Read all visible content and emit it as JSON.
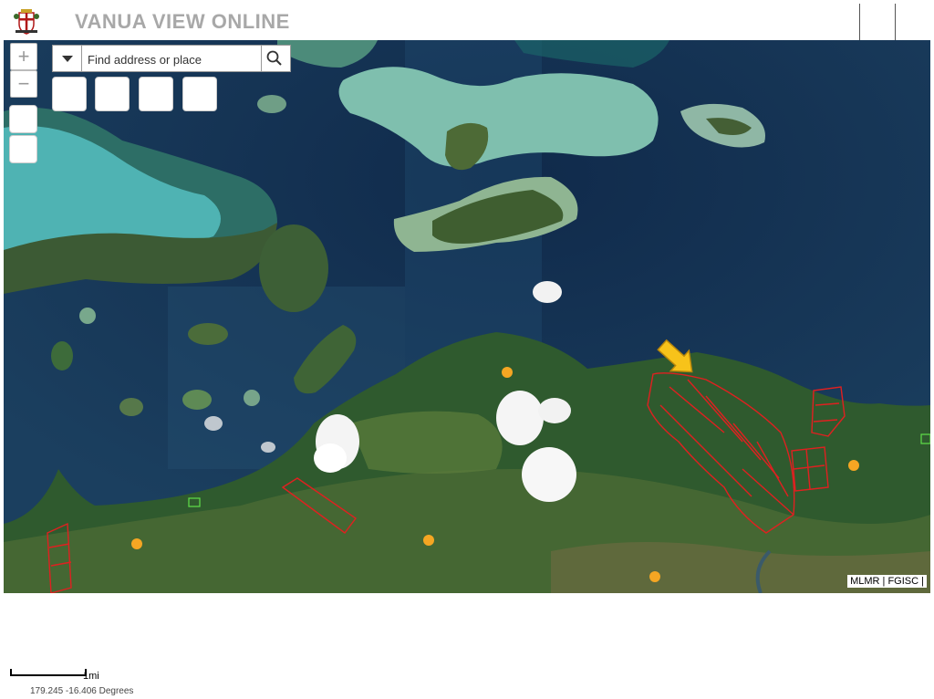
{
  "header": {
    "title": "VANUA VIEW ONLINE",
    "logo": "coat-of-arms-logo"
  },
  "search": {
    "placeholder": "Find address or place",
    "dropdown_icon": "caret-down-icon",
    "search_icon": "magnifier-icon"
  },
  "zoom": {
    "in_label": "+",
    "out_label": "−"
  },
  "map": {
    "basemap": "satellite",
    "parcel_color": "#e02020",
    "marker_color": "#f5a623",
    "pointer_color": "#f7c31a"
  },
  "attribution": "MLMR | FGISC |",
  "scale": {
    "label": "1mi"
  },
  "coordinates": "179.245 -16.406 Degrees"
}
